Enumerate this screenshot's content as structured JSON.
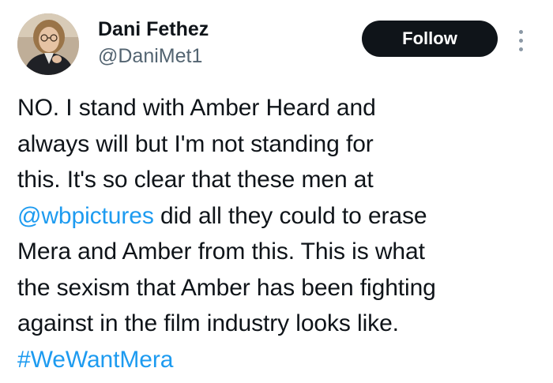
{
  "author": {
    "display_name": "Dani Fethez",
    "handle": "@DaniMet1"
  },
  "follow_button": {
    "label": "Follow"
  },
  "more_menu": {
    "icon": "more-vertical-icon"
  },
  "tweet": {
    "lines": {
      "l1": "NO. I stand with Amber Heard and",
      "l2": "always will but I'm not standing for",
      "l3": "this. It's so clear that these men at",
      "l4_mention": "@wbpictures",
      "l4_rest": " did all they could to erase",
      "l5": "Mera and Amber from this. This is what",
      "l6": "the sexism that Amber has been fighting",
      "l7": "against in the film industry looks like.",
      "l8_hashtag": "#WeWantMera"
    }
  },
  "colors": {
    "text": "#0f1419",
    "secondary_text": "#536471",
    "link": "#1d9bf0",
    "follow_bg": "#0f1419",
    "follow_text": "#ffffff"
  }
}
